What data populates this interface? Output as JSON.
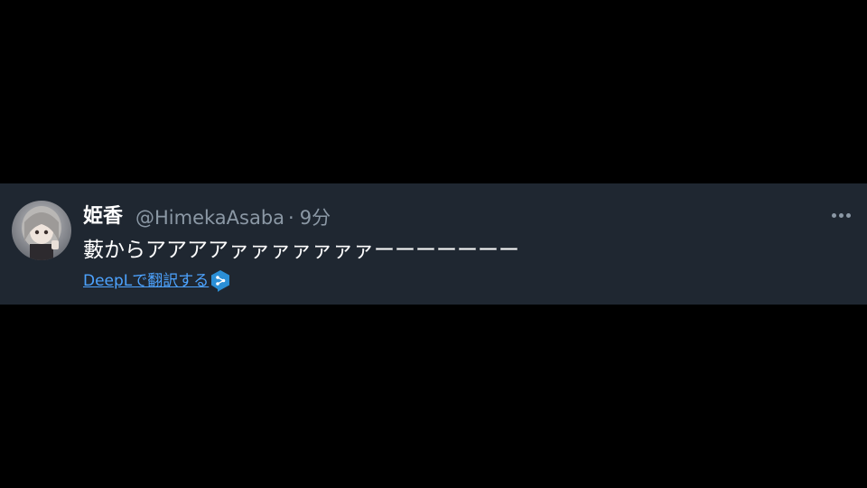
{
  "tweet": {
    "display_name": "姫香",
    "handle": "@HimekaAsaba",
    "separator": "·",
    "time": "9分",
    "text": "藪からアアアアァァァァァァァーーーーーーー",
    "translate_label": "DeepLで翻訳する"
  },
  "icons": {
    "more": "more-horizontal-icon",
    "translate": "deepl-icon"
  },
  "colors": {
    "background": "#000000",
    "card": "#1f2731",
    "name": "#ffffff",
    "secondary": "#8b98a5",
    "link": "#4da3ff",
    "deepl": "#2b8fd6"
  }
}
